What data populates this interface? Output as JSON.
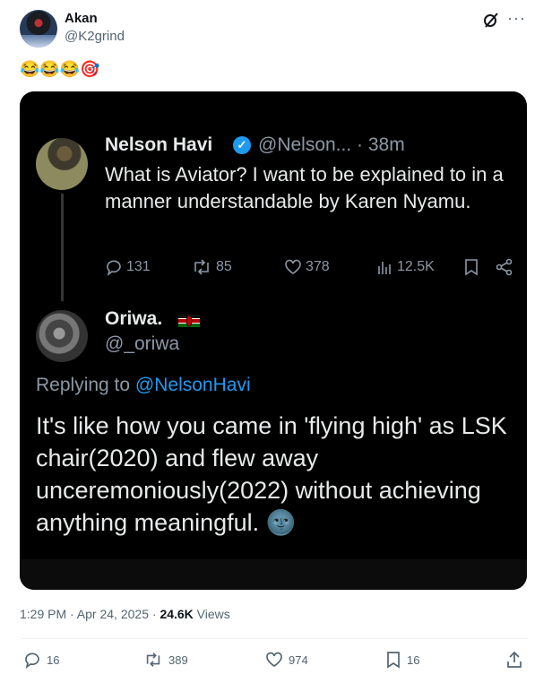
{
  "post": {
    "author_name": "Akan",
    "author_handle": "@K2grind",
    "text": "😂😂😂🎯",
    "timestamp": "1:29 PM · Apr 24, 2025",
    "separator": " · ",
    "views_count": "24.6K",
    "views_label": " Views"
  },
  "embedded": {
    "tweet1": {
      "name": "Nelson Havi",
      "handle": "@Nelson... · 38m",
      "text": "What is Aviator? I want to be explained to in a manner understandable by Karen Nyamu.",
      "replies": "131",
      "reposts": "85",
      "likes": "378",
      "views": "12.5K"
    },
    "tweet2": {
      "name": "Oriwa.",
      "handle": "@_oriwa",
      "replying_prefix": "Replying to ",
      "replying_mention": "@NelsonHavi",
      "text": "It's like how you came in 'flying high' as LSK chair(2020) and flew away unceremoniously(2022) without achieving anything meaningful. 🌚"
    }
  },
  "actions": {
    "replies": "16",
    "reposts": "389",
    "likes": "974",
    "bookmarks": "16"
  },
  "colors": {
    "text_primary": "#0f1419",
    "text_secondary": "#536471",
    "link_blue": "#1d9bf0",
    "dark_bg": "#000000"
  }
}
